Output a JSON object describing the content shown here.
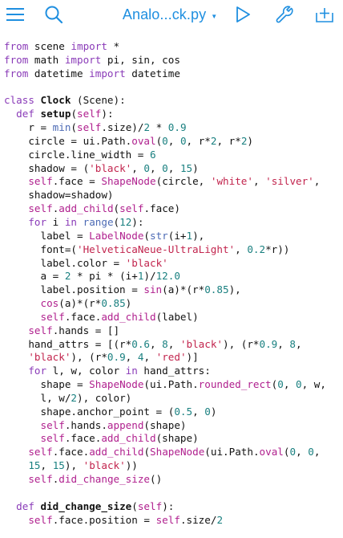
{
  "toolbar": {
    "file_title": "Analo...ck.py",
    "icons": [
      "hamburger-menu-icon",
      "search-icon",
      "chevron-down-icon",
      "play-icon",
      "wrench-icon",
      "add-tab-icon"
    ]
  },
  "colors": {
    "accent": "#1f8fe0",
    "keyword": "#8a3bb8",
    "function_name": "#b0208e",
    "builtin": "#4d6bb5",
    "string": "#c2244d",
    "number": "#1a8080",
    "text": "#111111"
  },
  "code_lines": [
    [
      [
        "from",
        "kw"
      ],
      [
        " scene ",
        "pl"
      ],
      [
        "import",
        "kw"
      ],
      [
        " *",
        "op"
      ]
    ],
    [
      [
        "from",
        "kw"
      ],
      [
        " math ",
        "pl"
      ],
      [
        "import",
        "kw"
      ],
      [
        " pi, sin, cos",
        "pl"
      ]
    ],
    [
      [
        "from",
        "kw"
      ],
      [
        " datetime ",
        "pl"
      ],
      [
        "import",
        "kw"
      ],
      [
        " datetime",
        "pl"
      ]
    ],
    [],
    [
      [
        "class",
        "kw"
      ],
      [
        " ",
        "pl"
      ],
      [
        "Clock",
        "nc"
      ],
      [
        " (Scene):",
        "pl"
      ]
    ],
    [
      [
        "  ",
        "pl"
      ],
      [
        "def",
        "kw"
      ],
      [
        " ",
        "pl"
      ],
      [
        "setup",
        "nc"
      ],
      [
        "(",
        "pl"
      ],
      [
        "self",
        "sf"
      ],
      [
        "):",
        "pl"
      ]
    ],
    [
      [
        "    r = ",
        "pl"
      ],
      [
        "min",
        "bi"
      ],
      [
        "(",
        "pl"
      ],
      [
        "self",
        "sf"
      ],
      [
        ".size)/",
        "pl"
      ],
      [
        "2",
        "nm"
      ],
      [
        " * ",
        "op"
      ],
      [
        "0.9",
        "nm"
      ]
    ],
    [
      [
        "    circle = ui.Path.",
        "pl"
      ],
      [
        "oval",
        "fn"
      ],
      [
        "(",
        "pl"
      ],
      [
        "0",
        "nm"
      ],
      [
        ", ",
        "pl"
      ],
      [
        "0",
        "nm"
      ],
      [
        ", r*",
        "pl"
      ],
      [
        "2",
        "nm"
      ],
      [
        ", r*",
        "pl"
      ],
      [
        "2",
        "nm"
      ],
      [
        ")",
        "pl"
      ]
    ],
    [
      [
        "    circle.line_width = ",
        "pl"
      ],
      [
        "6",
        "nm"
      ]
    ],
    [
      [
        "    shadow = (",
        "pl"
      ],
      [
        "'black'",
        "st"
      ],
      [
        ", ",
        "pl"
      ],
      [
        "0",
        "nm"
      ],
      [
        ", ",
        "pl"
      ],
      [
        "0",
        "nm"
      ],
      [
        ", ",
        "pl"
      ],
      [
        "15",
        "nm"
      ],
      [
        ")",
        "pl"
      ]
    ],
    [
      [
        "    ",
        "pl"
      ],
      [
        "self",
        "sf"
      ],
      [
        ".face = ",
        "pl"
      ],
      [
        "ShapeNode",
        "fn"
      ],
      [
        "(circle, ",
        "pl"
      ],
      [
        "'white'",
        "st"
      ],
      [
        ", ",
        "pl"
      ],
      [
        "'silver'",
        "st"
      ],
      [
        ",",
        "pl"
      ]
    ],
    [
      [
        "    shadow=shadow)",
        "pl"
      ]
    ],
    [
      [
        "    ",
        "pl"
      ],
      [
        "self",
        "sf"
      ],
      [
        ".",
        "pl"
      ],
      [
        "add_child",
        "fn"
      ],
      [
        "(",
        "pl"
      ],
      [
        "self",
        "sf"
      ],
      [
        ".face)",
        "pl"
      ]
    ],
    [
      [
        "    ",
        "pl"
      ],
      [
        "for",
        "kw"
      ],
      [
        " i ",
        "pl"
      ],
      [
        "in",
        "kw"
      ],
      [
        " ",
        "pl"
      ],
      [
        "range",
        "bi"
      ],
      [
        "(",
        "pl"
      ],
      [
        "12",
        "nm"
      ],
      [
        "):",
        "pl"
      ]
    ],
    [
      [
        "      label = ",
        "pl"
      ],
      [
        "LabelNode",
        "fn"
      ],
      [
        "(",
        "pl"
      ],
      [
        "str",
        "bi"
      ],
      [
        "(i+",
        "pl"
      ],
      [
        "1",
        "nm"
      ],
      [
        "),",
        "pl"
      ]
    ],
    [
      [
        "      font=(",
        "pl"
      ],
      [
        "'HelveticaNeue-UltraLight'",
        "st"
      ],
      [
        ", ",
        "pl"
      ],
      [
        "0.2",
        "nm"
      ],
      [
        "*r))",
        "pl"
      ]
    ],
    [
      [
        "      label.color = ",
        "pl"
      ],
      [
        "'black'",
        "st"
      ]
    ],
    [
      [
        "      a = ",
        "pl"
      ],
      [
        "2",
        "nm"
      ],
      [
        " * pi * (i+",
        "pl"
      ],
      [
        "1",
        "nm"
      ],
      [
        ")/",
        "pl"
      ],
      [
        "12.0",
        "nm"
      ]
    ],
    [
      [
        "      label.position = ",
        "pl"
      ],
      [
        "sin",
        "fn"
      ],
      [
        "(a)*(r*",
        "pl"
      ],
      [
        "0.85",
        "nm"
      ],
      [
        "),",
        "pl"
      ]
    ],
    [
      [
        "      ",
        "pl"
      ],
      [
        "cos",
        "fn"
      ],
      [
        "(a)*(r*",
        "pl"
      ],
      [
        "0.85",
        "nm"
      ],
      [
        ")",
        "pl"
      ]
    ],
    [
      [
        "      ",
        "pl"
      ],
      [
        "self",
        "sf"
      ],
      [
        ".face.",
        "pl"
      ],
      [
        "add_child",
        "fn"
      ],
      [
        "(label)",
        "pl"
      ]
    ],
    [
      [
        "    ",
        "pl"
      ],
      [
        "self",
        "sf"
      ],
      [
        ".hands = []",
        "pl"
      ]
    ],
    [
      [
        "    hand_attrs = [(r*",
        "pl"
      ],
      [
        "0.6",
        "nm"
      ],
      [
        ", ",
        "pl"
      ],
      [
        "8",
        "nm"
      ],
      [
        ", ",
        "pl"
      ],
      [
        "'black'",
        "st"
      ],
      [
        "), (r*",
        "pl"
      ],
      [
        "0.9",
        "nm"
      ],
      [
        ", ",
        "pl"
      ],
      [
        "8",
        "nm"
      ],
      [
        ",",
        "pl"
      ]
    ],
    [
      [
        "    ",
        "pl"
      ],
      [
        "'black'",
        "st"
      ],
      [
        "), (r*",
        "pl"
      ],
      [
        "0.9",
        "nm"
      ],
      [
        ", ",
        "pl"
      ],
      [
        "4",
        "nm"
      ],
      [
        ", ",
        "pl"
      ],
      [
        "'red'",
        "st"
      ],
      [
        ")]",
        "pl"
      ]
    ],
    [
      [
        "    ",
        "pl"
      ],
      [
        "for",
        "kw"
      ],
      [
        " l, w, color ",
        "pl"
      ],
      [
        "in",
        "kw"
      ],
      [
        " hand_attrs:",
        "pl"
      ]
    ],
    [
      [
        "      shape = ",
        "pl"
      ],
      [
        "ShapeNode",
        "fn"
      ],
      [
        "(ui.Path.",
        "pl"
      ],
      [
        "rounded_rect",
        "fn"
      ],
      [
        "(",
        "pl"
      ],
      [
        "0",
        "nm"
      ],
      [
        ", ",
        "pl"
      ],
      [
        "0",
        "nm"
      ],
      [
        ", w,",
        "pl"
      ]
    ],
    [
      [
        "      l, w/",
        "pl"
      ],
      [
        "2",
        "nm"
      ],
      [
        "), color)",
        "pl"
      ]
    ],
    [
      [
        "      shape.anchor_point = (",
        "pl"
      ],
      [
        "0.5",
        "nm"
      ],
      [
        ", ",
        "pl"
      ],
      [
        "0",
        "nm"
      ],
      [
        ")",
        "pl"
      ]
    ],
    [
      [
        "      ",
        "pl"
      ],
      [
        "self",
        "sf"
      ],
      [
        ".hands.",
        "pl"
      ],
      [
        "append",
        "fn"
      ],
      [
        "(shape)",
        "pl"
      ]
    ],
    [
      [
        "      ",
        "pl"
      ],
      [
        "self",
        "sf"
      ],
      [
        ".face.",
        "pl"
      ],
      [
        "add_child",
        "fn"
      ],
      [
        "(shape)",
        "pl"
      ]
    ],
    [
      [
        "    ",
        "pl"
      ],
      [
        "self",
        "sf"
      ],
      [
        ".face.",
        "pl"
      ],
      [
        "add_child",
        "fn"
      ],
      [
        "(",
        "pl"
      ],
      [
        "ShapeNode",
        "fn"
      ],
      [
        "(ui.Path.",
        "pl"
      ],
      [
        "oval",
        "fn"
      ],
      [
        "(",
        "pl"
      ],
      [
        "0",
        "nm"
      ],
      [
        ", ",
        "pl"
      ],
      [
        "0",
        "nm"
      ],
      [
        ",",
        "pl"
      ]
    ],
    [
      [
        "    ",
        "pl"
      ],
      [
        "15",
        "nm"
      ],
      [
        ", ",
        "pl"
      ],
      [
        "15",
        "nm"
      ],
      [
        "), ",
        "pl"
      ],
      [
        "'black'",
        "st"
      ],
      [
        "))",
        "pl"
      ]
    ],
    [
      [
        "    ",
        "pl"
      ],
      [
        "self",
        "sf"
      ],
      [
        ".",
        "pl"
      ],
      [
        "did_change_size",
        "fn"
      ],
      [
        "()",
        "pl"
      ]
    ],
    [],
    [
      [
        "  ",
        "pl"
      ],
      [
        "def",
        "kw"
      ],
      [
        " ",
        "pl"
      ],
      [
        "did_change_size",
        "nc"
      ],
      [
        "(",
        "pl"
      ],
      [
        "self",
        "sf"
      ],
      [
        "):",
        "pl"
      ]
    ],
    [
      [
        "    ",
        "pl"
      ],
      [
        "self",
        "sf"
      ],
      [
        ".face.position = ",
        "pl"
      ],
      [
        "self",
        "sf"
      ],
      [
        ".size/",
        "pl"
      ],
      [
        "2",
        "nm"
      ]
    ]
  ]
}
